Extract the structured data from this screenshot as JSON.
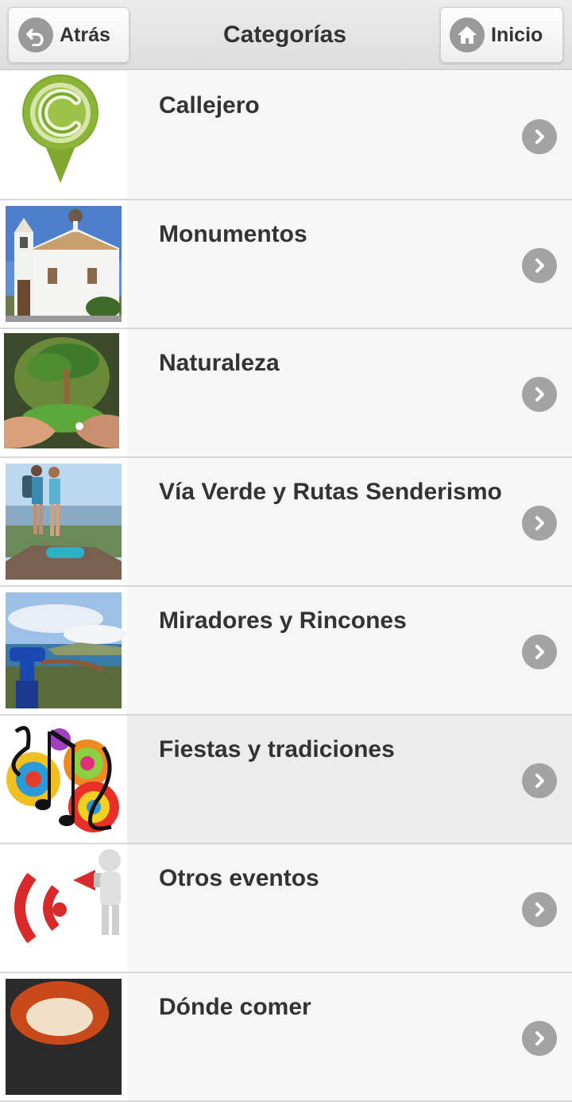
{
  "header": {
    "back_label": "Atrás",
    "title": "Categorías",
    "home_label": "Inicio"
  },
  "categories": [
    {
      "label": "Callejero",
      "icon": "map-pin-c-icon"
    },
    {
      "label": "Monumentos",
      "icon": "church-photo"
    },
    {
      "label": "Naturaleza",
      "icon": "tree-in-hands-photo"
    },
    {
      "label": "Vía Verde y Rutas Senderismo",
      "icon": "hikers-photo"
    },
    {
      "label": "Miradores y Rincones",
      "icon": "binoculars-viewpoint-photo"
    },
    {
      "label": "Fiestas y tradiciones",
      "icon": "music-notes-image"
    },
    {
      "label": "Otros eventos",
      "icon": "megaphone-figure-image"
    },
    {
      "label": "Dónde comer",
      "icon": "food-photo"
    }
  ],
  "colors": {
    "background": "#f6f6f6",
    "header": "#e4e4e4",
    "chevron": "#a3a3a3",
    "text": "#333333",
    "pin_green": "#8cb43a"
  }
}
